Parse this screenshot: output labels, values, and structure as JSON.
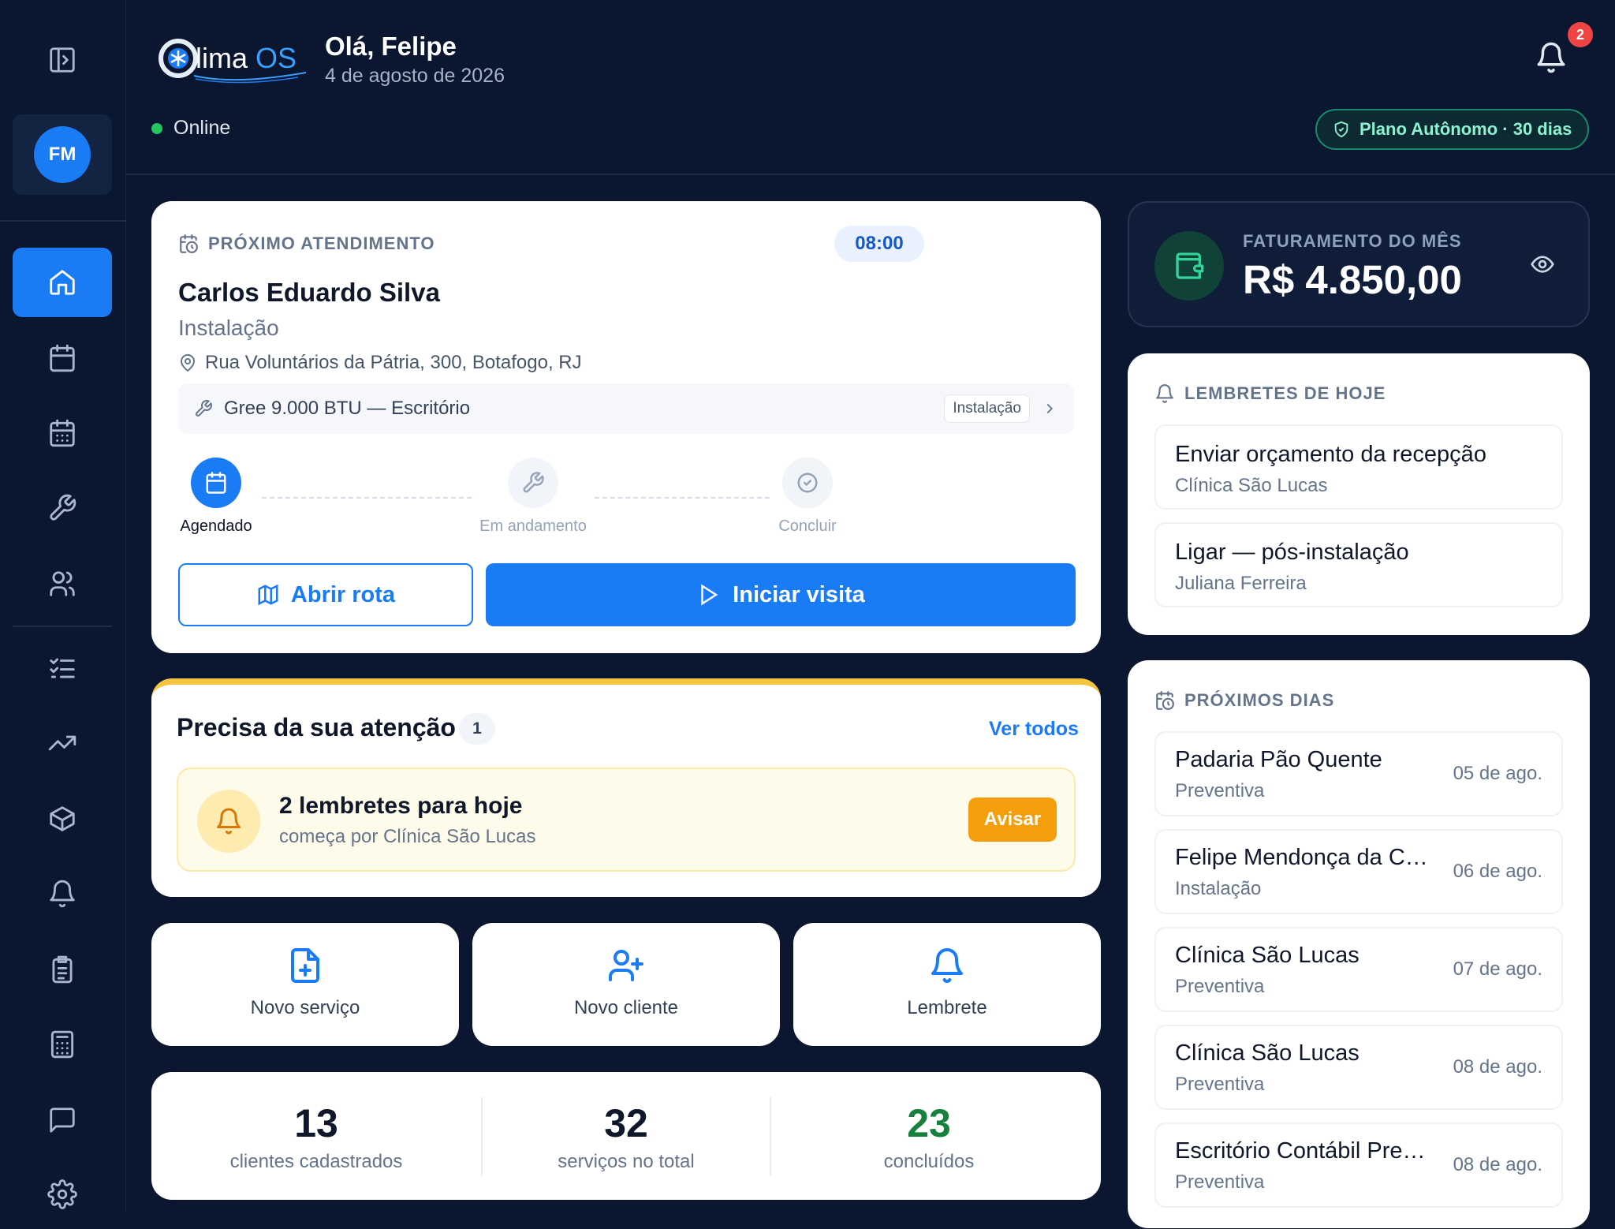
{
  "brand": {
    "logo_text": "ClimaOS"
  },
  "header": {
    "greeting": "Olá, Felipe",
    "date": "4 de agosto de 2026",
    "status": "Online",
    "notifications_count": "2",
    "plan_badge": "Plano Autônomo · 30 dias"
  },
  "user": {
    "initials": "FM"
  },
  "sidebar": {
    "items": [
      {
        "icon": "sidebar-toggle-icon"
      },
      {
        "icon": "home-icon",
        "active": true
      },
      {
        "icon": "calendar-icon"
      },
      {
        "icon": "calendar-grid-icon"
      },
      {
        "icon": "wrench-icon"
      },
      {
        "icon": "users-icon"
      },
      {
        "icon": "checklist-icon"
      },
      {
        "icon": "trending-up-icon"
      },
      {
        "icon": "package-icon"
      },
      {
        "icon": "bell-icon"
      },
      {
        "icon": "clipboard-icon"
      },
      {
        "icon": "calculator-icon"
      },
      {
        "icon": "message-icon"
      },
      {
        "icon": "settings-icon"
      }
    ]
  },
  "next_appointment": {
    "label": "PRÓXIMO ATENDIMENTO",
    "time": "08:00",
    "client": "Carlos Eduardo Silva",
    "service": "Instalação",
    "address": "Rua Voluntários da Pátria, 300, Botafogo, RJ",
    "equipment": "Gree 9.000 BTU — Escritório",
    "equipment_tag": "Instalação",
    "steps": [
      {
        "label": "Agendado",
        "state": "active"
      },
      {
        "label": "Em andamento",
        "state": "pending"
      },
      {
        "label": "Concluir",
        "state": "pending"
      }
    ],
    "route_button": "Abrir rota",
    "start_button": "Iniciar visita"
  },
  "attention": {
    "title": "Precisa da sua atenção",
    "count": "1",
    "see_all": "Ver todos",
    "alert_title": "2 lembretes para hoje",
    "alert_subtitle": "começa por Clínica São Lucas",
    "alert_button": "Avisar",
    "accent_color": "#f5c542"
  },
  "quick_actions": [
    {
      "label": "Novo serviço",
      "icon": "file-plus-icon"
    },
    {
      "label": "Novo cliente",
      "icon": "user-plus-icon"
    },
    {
      "label": "Lembrete",
      "icon": "bell-icon"
    }
  ],
  "stats": [
    {
      "value": "13",
      "label": "clientes cadastrados",
      "color": "#0f172a"
    },
    {
      "value": "32",
      "label": "serviços no total",
      "color": "#0f172a"
    },
    {
      "value": "23",
      "label": "concluídos",
      "color": "#16803c"
    }
  ],
  "revenue": {
    "label": "FATURAMENTO DO MÊS",
    "value": "R$ 4.850,00"
  },
  "reminders": {
    "label": "LEMBRETES DE HOJE",
    "items": [
      {
        "title": "Enviar orçamento da recepção",
        "subtitle": "Clínica São Lucas"
      },
      {
        "title": "Ligar — pós-instalação",
        "subtitle": "Juliana Ferreira"
      }
    ]
  },
  "upcoming": {
    "label": "PRÓXIMOS DIAS",
    "items": [
      {
        "title": "Padaria Pão Quente",
        "subtitle": "Preventiva",
        "date": "05 de ago."
      },
      {
        "title": "Felipe Mendonça da Costa",
        "subtitle": "Instalação",
        "date": "06 de ago."
      },
      {
        "title": "Clínica São Lucas",
        "subtitle": "Preventiva",
        "date": "07 de ago."
      },
      {
        "title": "Clínica São Lucas",
        "subtitle": "Preventiva",
        "date": "08 de ago."
      },
      {
        "title": "Escritório Contábil Prestes",
        "subtitle": "Preventiva",
        "date": "08 de ago."
      }
    ]
  },
  "colors": {
    "primary": "#1a7cf5",
    "background": "#0b1630",
    "success": "#22c55e",
    "warning": "#f59e0b"
  }
}
